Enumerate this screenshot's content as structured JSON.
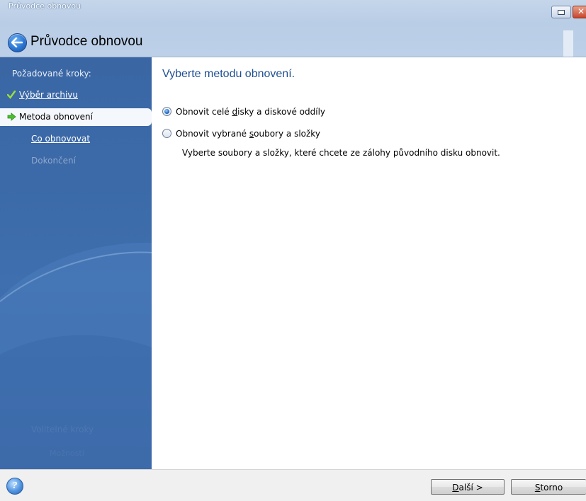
{
  "window": {
    "title": "Průvodce obnovou",
    "controls": {
      "minimize_icon": "minimize-icon",
      "close_icon": "close-icon"
    }
  },
  "header": {
    "back_icon": "back-arrow-icon",
    "title": "Průvodce obnovou"
  },
  "sidebar": {
    "heading": "Požadované kroky:",
    "steps": [
      {
        "label": "Výběr archivu",
        "state": "done",
        "icon": "checkmark-icon"
      },
      {
        "label": "Metoda obnovení",
        "state": "current",
        "icon": "green-arrow-icon"
      },
      {
        "label": "Co obnovovat",
        "state": "next"
      },
      {
        "label": "Dokončení",
        "state": "disabled"
      }
    ],
    "optional_heading": "Volitelné kroky",
    "optional_item": "Možnosti"
  },
  "main": {
    "title": "Vyberte metodu obnovení.",
    "options": [
      {
        "label_pre": "Obnovit celé ",
        "label_mnemonic": "d",
        "label_post": "isky a diskové oddíly",
        "selected": true
      },
      {
        "label_pre": "Obnovit vybrané ",
        "label_mnemonic": "s",
        "label_post": "oubory a složky",
        "selected": false
      }
    ],
    "hint": "Vyberte soubory a složky, které chcete ze zálohy původního disku obnovit."
  },
  "footer": {
    "help_icon": "help-icon",
    "next_mnemonic": "D",
    "next_rest": "alší >",
    "cancel_mnemonic": "S",
    "cancel_rest": "torno"
  },
  "colors": {
    "sidebar": "#3c6aa8",
    "title_accent": "#1e4f92",
    "titlebar": "#bcd0e8"
  }
}
